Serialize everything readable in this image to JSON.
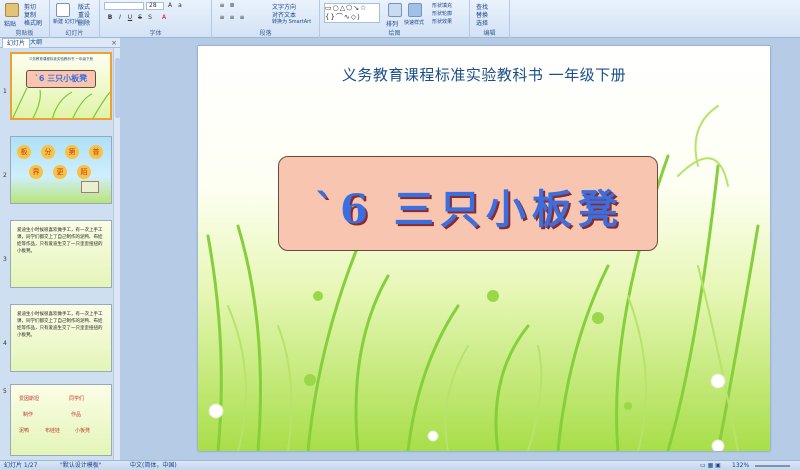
{
  "ribbon": {
    "clipboard": {
      "paste": "粘贴",
      "cut": "剪切",
      "copy": "复制",
      "format_painter": "格式刷",
      "group": "剪贴板"
    },
    "slides": {
      "new": "新建\n幻灯片",
      "layout": "版式",
      "reset": "重设",
      "delete": "删除",
      "group": "幻灯片"
    },
    "font": {
      "size": "28",
      "group": "字体"
    },
    "paragraph": {
      "text_direction": "文字方向",
      "align_text": "对齐文本",
      "smartart": "转换为 SmartArt",
      "group": "段落"
    },
    "drawing": {
      "arrange": "排列",
      "quick_styles": "快速样式",
      "fill": "形状填充",
      "outline": "形状轮廓",
      "effects": "形状效果",
      "group": "绘图"
    },
    "editing": {
      "find": "查找",
      "replace": "替换",
      "select": "选择",
      "group": "编辑"
    }
  },
  "panel": {
    "tab_slides": "幻灯片",
    "tab_outline": "大纲",
    "close": "×",
    "thumbs": [
      {
        "num": "1",
        "heading": "义务教育课程标准实验教科书  一年级下册",
        "title": "`6 三只小板凳"
      },
      {
        "num": "2",
        "chars": [
          "板",
          "分",
          "第",
          "普",
          "界",
          "更",
          "陌"
        ]
      },
      {
        "num": "3",
        "text": "爱迪生小时候很喜欢做手工，有一次上手工课，同学们都交上了自己制作的泥鸭、布娃娃等作品，只有爱迪生交了一只歪歪扭扭的小板凳。"
      },
      {
        "num": "4",
        "text": "爱迪生小时候很喜欢做手工，有一次上手工课，同学们都交上了自己制作的泥鸭、布娃娃等作品，只有爱迪生交了一只歪歪扭扭的小板凳。"
      },
      {
        "num": "5",
        "words": [
          "爱因斯坦",
          "同学们",
          "制作",
          "作品",
          "泥鸭",
          "布娃娃",
          "小板凳"
        ]
      }
    ]
  },
  "slide": {
    "heading": "义务教育课程标准实验教科书   一年级下册",
    "title": "`6 三只小板凳"
  },
  "status": {
    "slide_info": "幻灯片 1/27",
    "theme": "\"默认设计模板\"",
    "language": "中文(简体，中国)",
    "zoom": "132%"
  },
  "colors": {
    "ribbon": "#d3e2f5",
    "panel": "#cfdff2",
    "title_box": "#f8c6b0",
    "title_text": "#3b6fe0",
    "heading": "#1a4e8a"
  }
}
